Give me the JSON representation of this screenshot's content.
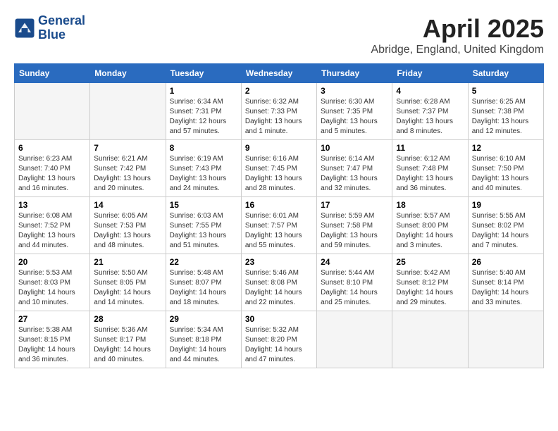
{
  "header": {
    "logo_line1": "General",
    "logo_line2": "Blue",
    "month": "April 2025",
    "location": "Abridge, England, United Kingdom"
  },
  "days_of_week": [
    "Sunday",
    "Monday",
    "Tuesday",
    "Wednesday",
    "Thursday",
    "Friday",
    "Saturday"
  ],
  "weeks": [
    [
      {
        "num": "",
        "info": ""
      },
      {
        "num": "",
        "info": ""
      },
      {
        "num": "1",
        "info": "Sunrise: 6:34 AM\nSunset: 7:31 PM\nDaylight: 12 hours\nand 57 minutes."
      },
      {
        "num": "2",
        "info": "Sunrise: 6:32 AM\nSunset: 7:33 PM\nDaylight: 13 hours\nand 1 minute."
      },
      {
        "num": "3",
        "info": "Sunrise: 6:30 AM\nSunset: 7:35 PM\nDaylight: 13 hours\nand 5 minutes."
      },
      {
        "num": "4",
        "info": "Sunrise: 6:28 AM\nSunset: 7:37 PM\nDaylight: 13 hours\nand 8 minutes."
      },
      {
        "num": "5",
        "info": "Sunrise: 6:25 AM\nSunset: 7:38 PM\nDaylight: 13 hours\nand 12 minutes."
      }
    ],
    [
      {
        "num": "6",
        "info": "Sunrise: 6:23 AM\nSunset: 7:40 PM\nDaylight: 13 hours\nand 16 minutes."
      },
      {
        "num": "7",
        "info": "Sunrise: 6:21 AM\nSunset: 7:42 PM\nDaylight: 13 hours\nand 20 minutes."
      },
      {
        "num": "8",
        "info": "Sunrise: 6:19 AM\nSunset: 7:43 PM\nDaylight: 13 hours\nand 24 minutes."
      },
      {
        "num": "9",
        "info": "Sunrise: 6:16 AM\nSunset: 7:45 PM\nDaylight: 13 hours\nand 28 minutes."
      },
      {
        "num": "10",
        "info": "Sunrise: 6:14 AM\nSunset: 7:47 PM\nDaylight: 13 hours\nand 32 minutes."
      },
      {
        "num": "11",
        "info": "Sunrise: 6:12 AM\nSunset: 7:48 PM\nDaylight: 13 hours\nand 36 minutes."
      },
      {
        "num": "12",
        "info": "Sunrise: 6:10 AM\nSunset: 7:50 PM\nDaylight: 13 hours\nand 40 minutes."
      }
    ],
    [
      {
        "num": "13",
        "info": "Sunrise: 6:08 AM\nSunset: 7:52 PM\nDaylight: 13 hours\nand 44 minutes."
      },
      {
        "num": "14",
        "info": "Sunrise: 6:05 AM\nSunset: 7:53 PM\nDaylight: 13 hours\nand 48 minutes."
      },
      {
        "num": "15",
        "info": "Sunrise: 6:03 AM\nSunset: 7:55 PM\nDaylight: 13 hours\nand 51 minutes."
      },
      {
        "num": "16",
        "info": "Sunrise: 6:01 AM\nSunset: 7:57 PM\nDaylight: 13 hours\nand 55 minutes."
      },
      {
        "num": "17",
        "info": "Sunrise: 5:59 AM\nSunset: 7:58 PM\nDaylight: 13 hours\nand 59 minutes."
      },
      {
        "num": "18",
        "info": "Sunrise: 5:57 AM\nSunset: 8:00 PM\nDaylight: 14 hours\nand 3 minutes."
      },
      {
        "num": "19",
        "info": "Sunrise: 5:55 AM\nSunset: 8:02 PM\nDaylight: 14 hours\nand 7 minutes."
      }
    ],
    [
      {
        "num": "20",
        "info": "Sunrise: 5:53 AM\nSunset: 8:03 PM\nDaylight: 14 hours\nand 10 minutes."
      },
      {
        "num": "21",
        "info": "Sunrise: 5:50 AM\nSunset: 8:05 PM\nDaylight: 14 hours\nand 14 minutes."
      },
      {
        "num": "22",
        "info": "Sunrise: 5:48 AM\nSunset: 8:07 PM\nDaylight: 14 hours\nand 18 minutes."
      },
      {
        "num": "23",
        "info": "Sunrise: 5:46 AM\nSunset: 8:08 PM\nDaylight: 14 hours\nand 22 minutes."
      },
      {
        "num": "24",
        "info": "Sunrise: 5:44 AM\nSunset: 8:10 PM\nDaylight: 14 hours\nand 25 minutes."
      },
      {
        "num": "25",
        "info": "Sunrise: 5:42 AM\nSunset: 8:12 PM\nDaylight: 14 hours\nand 29 minutes."
      },
      {
        "num": "26",
        "info": "Sunrise: 5:40 AM\nSunset: 8:14 PM\nDaylight: 14 hours\nand 33 minutes."
      }
    ],
    [
      {
        "num": "27",
        "info": "Sunrise: 5:38 AM\nSunset: 8:15 PM\nDaylight: 14 hours\nand 36 minutes."
      },
      {
        "num": "28",
        "info": "Sunrise: 5:36 AM\nSunset: 8:17 PM\nDaylight: 14 hours\nand 40 minutes."
      },
      {
        "num": "29",
        "info": "Sunrise: 5:34 AM\nSunset: 8:18 PM\nDaylight: 14 hours\nand 44 minutes."
      },
      {
        "num": "30",
        "info": "Sunrise: 5:32 AM\nSunset: 8:20 PM\nDaylight: 14 hours\nand 47 minutes."
      },
      {
        "num": "",
        "info": ""
      },
      {
        "num": "",
        "info": ""
      },
      {
        "num": "",
        "info": ""
      }
    ]
  ]
}
